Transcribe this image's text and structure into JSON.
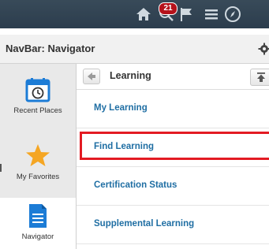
{
  "topbar": {
    "icons": [
      "home-icon",
      "search-icon",
      "flag-icon",
      "hamburger-menu-icon",
      "navbar-compass-icon"
    ],
    "notification_count": "21"
  },
  "panel": {
    "title": "NavBar: Navigator"
  },
  "sidebar": {
    "items": [
      {
        "label": "Recent Places",
        "icon": "calendar-clock-icon"
      },
      {
        "label": "My Favorites",
        "icon": "star-icon"
      },
      {
        "label": "Navigator",
        "icon": "document-icon"
      }
    ]
  },
  "content": {
    "title": "Learning",
    "items": [
      {
        "label": "My Learning"
      },
      {
        "label": "Find Learning"
      },
      {
        "label": "Certification Status"
      },
      {
        "label": "Supplemental Learning"
      }
    ],
    "highlighted_item": "Find Learning"
  },
  "colors": {
    "link": "#1f6ea3",
    "highlight_border": "#e31b23",
    "badge": "#b5121b",
    "star": "#f5a623",
    "nav_icon": "#1c7cd6"
  }
}
